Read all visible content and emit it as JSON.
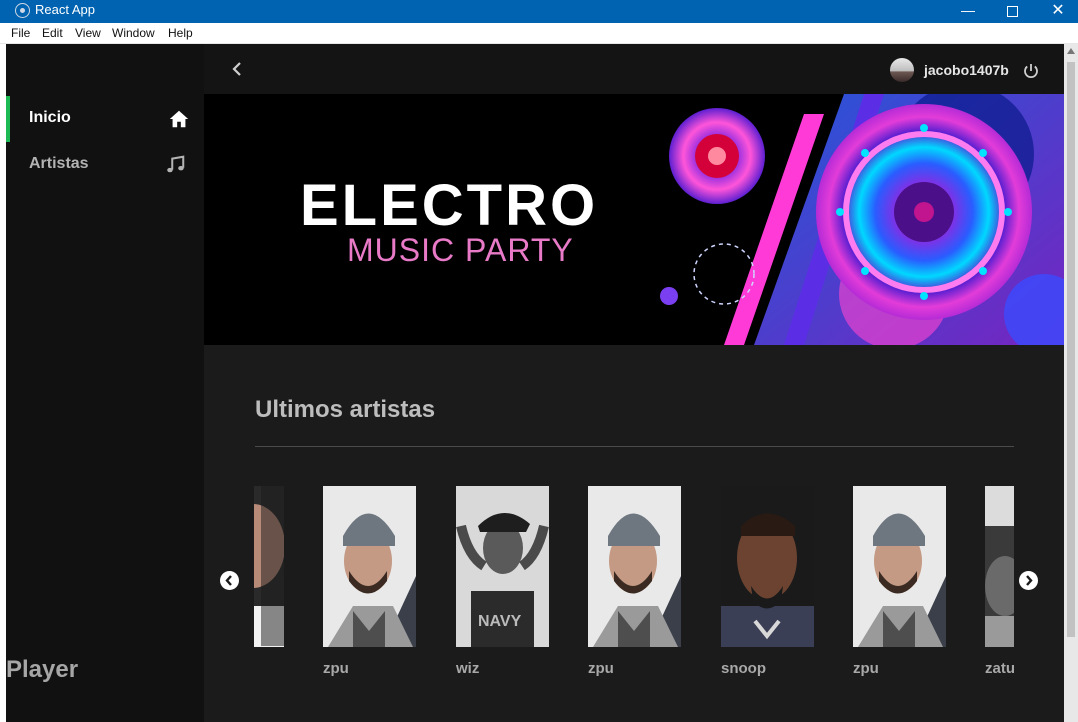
{
  "window": {
    "title": "React App",
    "controls": {
      "minimize": "—",
      "maximize": "",
      "close": "✕"
    }
  },
  "menu": [
    "File",
    "Edit",
    "View",
    "Window",
    "Help"
  ],
  "sidebar": {
    "items": [
      {
        "label": "Inicio",
        "icon": "home-icon",
        "active": true
      },
      {
        "label": "Artistas",
        "icon": "music-note-icon",
        "active": false
      }
    ],
    "player_label": "Player",
    "accent": "#1db954"
  },
  "topbar": {
    "username": "jacobo1407b"
  },
  "banner": {
    "title": "ELECTRO",
    "subtitle": "MUSIC PARTY"
  },
  "section": {
    "title": "Ultimos artistas"
  },
  "artists": [
    {
      "name": "",
      "photo": "partial-portrait"
    },
    {
      "name": "zpu",
      "photo": "beanie-portrait"
    },
    {
      "name": "wiz",
      "photo": "bw-portrait"
    },
    {
      "name": "zpu",
      "photo": "beanie-portrait"
    },
    {
      "name": "snoop",
      "photo": "snoop-portrait"
    },
    {
      "name": "zpu",
      "photo": "beanie-portrait"
    },
    {
      "name": "zatu",
      "photo": "dark-portrait"
    }
  ],
  "colors": {
    "titlebar": "#0063b1",
    "sidebar_bg": "#111111",
    "main_bg": "#1b1b1b",
    "banner_pink": "#e87ac8"
  }
}
